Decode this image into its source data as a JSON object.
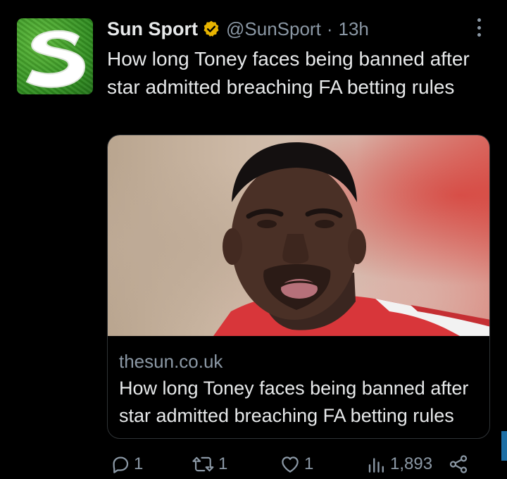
{
  "account": {
    "display_name": "Sun Sport",
    "handle": "@SunSport",
    "separator": "·",
    "time": "13h",
    "avatar_icon": "sun-sport-logo-icon",
    "verified_icon": "verified-badge-icon",
    "colors": {
      "verified": "#e8b400",
      "avatar_green": "#3a9a2a"
    }
  },
  "tweet": {
    "text": "How long Toney faces being banned after star admitted breaching FA betting rules"
  },
  "card": {
    "image_icon": "article-photo",
    "domain": "thesun.co.uk",
    "title": "How long Toney faces being banned after star admitted breaching FA betting rules"
  },
  "actions": {
    "reply": {
      "icon": "reply-icon",
      "count": "1"
    },
    "retweet": {
      "icon": "retweet-icon",
      "count": "1"
    },
    "like": {
      "icon": "heart-icon",
      "count": "1"
    },
    "views": {
      "icon": "views-icon",
      "count": "1,893"
    },
    "share": {
      "icon": "share-icon"
    }
  },
  "colors": {
    "background": "#000000",
    "text": "#e7e9ea",
    "muted": "#8b98a5",
    "border": "#2f3336"
  }
}
